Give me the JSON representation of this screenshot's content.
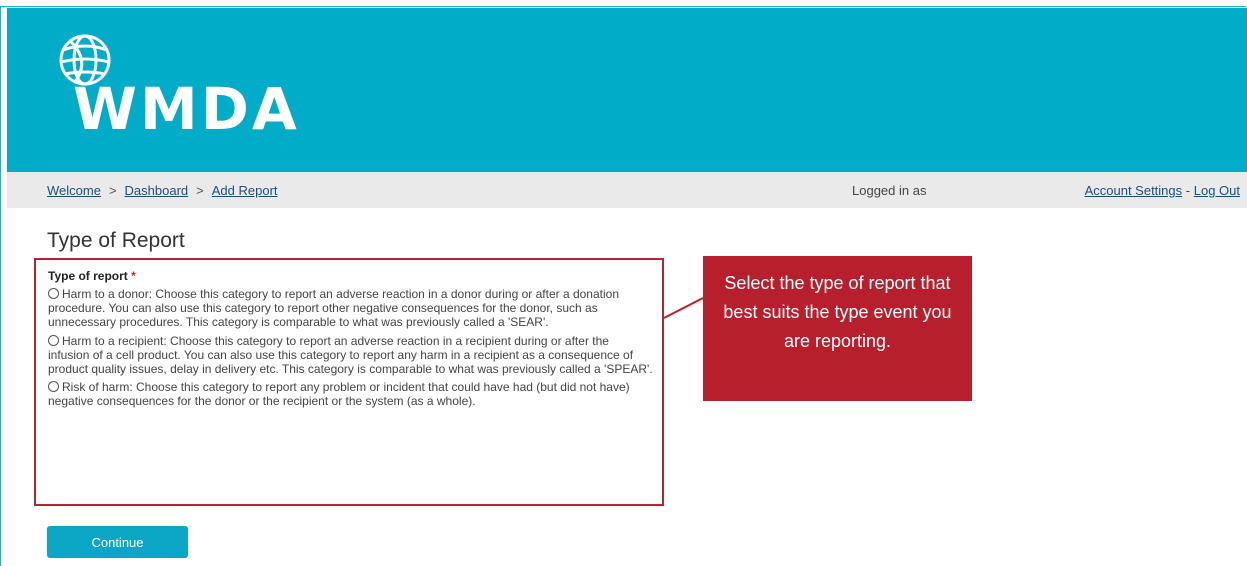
{
  "brand": {
    "name": "WMDA",
    "color": "#00acc8",
    "logo_icon": "globe-icon"
  },
  "nav": {
    "breadcrumbs": [
      "Welcome",
      "Dashboard",
      "Add Report"
    ],
    "separator": ">",
    "logged_in_label": "Logged in as",
    "account_settings": "Account Settings",
    "account_separator": "-",
    "log_out": "Log Out"
  },
  "page": {
    "title": "Type of Report"
  },
  "form": {
    "label": "Type of report",
    "required_marker": "*",
    "options": [
      {
        "label": "Harm to a donor: Choose this category to report an adverse reaction in a donor during or after a donation procedure. You can also use this category to report other negative consequences for the donor, such as unnecessary procedures. This category is comparable to what was previously called a 'SEAR'.",
        "selected": false
      },
      {
        "label": "Harm to a recipient: Choose this category to report an adverse reaction in a recipient during or after the infusion of a cell product. You can also use this category to report any harm in a recipient as a consequence of product quality issues, delay in delivery etc. This category is comparable to what was previously called a 'SPEAR'.",
        "selected": false
      },
      {
        "label": "Risk of harm: Choose this category to report any problem or incident that could have had (but did not have) negative consequences for the donor or the recipient or the system (as a whole).",
        "selected": false
      }
    ]
  },
  "callout": {
    "text": "Select the type of report that best suits the type event you are reporting.",
    "color": "#b81f2d"
  },
  "actions": {
    "continue_label": "Continue"
  }
}
